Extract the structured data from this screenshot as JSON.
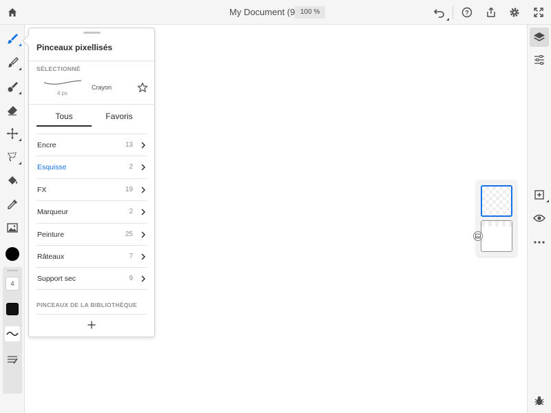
{
  "topbar": {
    "doc_title": "My Document (9)",
    "zoom": "100 %",
    "icons": [
      "home-icon",
      "undo-icon",
      "help-icon",
      "share-icon",
      "settings-icon",
      "fullscreen-icon"
    ]
  },
  "lefttoolbar": {
    "tools": [
      "brush-icon",
      "mixer-brush-icon",
      "smudge-icon",
      "eraser-icon",
      "move-icon",
      "lasso-icon",
      "fill-icon",
      "eyedropper-icon",
      "image-icon"
    ],
    "color": "#000000",
    "brush_size": "4",
    "swatch_color": "#111111"
  },
  "popover": {
    "title": "Pinceaux pixellisés",
    "selected_label": "SÉLECTIONNÉ",
    "selected_brush": {
      "size": "4 px",
      "name": "Crayon"
    },
    "tabs": [
      {
        "label": "Tous",
        "active": true
      },
      {
        "label": "Favoris",
        "active": false
      }
    ],
    "brushes": [
      {
        "label": "Encre",
        "count": "13",
        "highlight": false
      },
      {
        "label": "Esquisse",
        "count": "2",
        "highlight": true
      },
      {
        "label": "FX",
        "count": "19",
        "highlight": false
      },
      {
        "label": "Marqueur",
        "count": "2",
        "highlight": false
      },
      {
        "label": "Peinture",
        "count": "25",
        "highlight": false
      },
      {
        "label": "Râteaux",
        "count": "7",
        "highlight": false
      },
      {
        "label": "Support sec",
        "count": "9",
        "highlight": false
      }
    ],
    "library_label": "PINCEAUX DE LA BIBLIOTHÈQUE"
  },
  "rightbar": {
    "icons": [
      "layers-icon",
      "adjustments-icon",
      "add-layer-icon",
      "visibility-icon",
      "more-icon",
      "bug-icon"
    ]
  },
  "colors": {
    "accent": "#1473e6",
    "toolbar_bg": "#f5f5f5"
  }
}
